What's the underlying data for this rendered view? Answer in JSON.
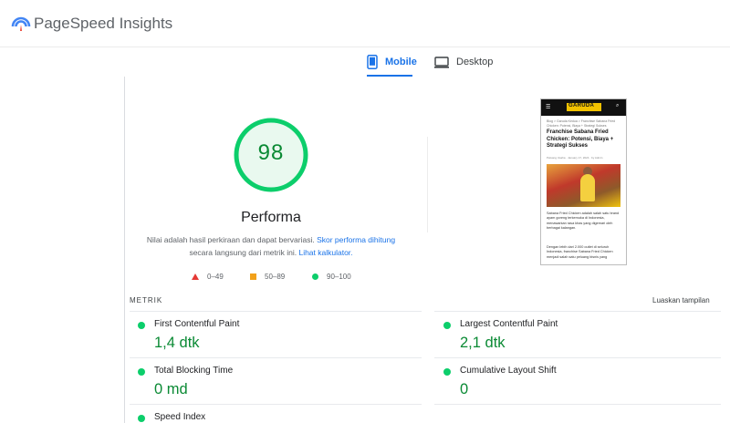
{
  "header": {
    "title": "PageSpeed Insights"
  },
  "tabs": [
    {
      "label": "Mobile",
      "active": true,
      "icon": "phone-icon"
    },
    {
      "label": "Desktop",
      "active": false,
      "icon": "monitor-icon"
    }
  ],
  "score": {
    "value": "98",
    "category": "Performa",
    "desc_prefix": "Nilai adalah hasil perkiraan dan dapat bervariasi. ",
    "desc_link1": "Skor performa dihitung",
    "desc_mid": "secara langsung dari metrik ini. ",
    "desc_link2": "Lihat kalkulator.",
    "color": "#0cce6b"
  },
  "legend": [
    {
      "range": "0–49",
      "shape": "triangle",
      "color": "#e53935"
    },
    {
      "range": "50–89",
      "shape": "square",
      "color": "#f2a11a"
    },
    {
      "range": "90–100",
      "shape": "circle",
      "color": "#0cce6b"
    }
  ],
  "preview": {
    "logo": "GARUDA",
    "breadcrumb": "Blog > Garuda Kedua > Franchise Sabana Fried Chicken: Potensi, Biaya + Strategi Sukses",
    "title": "Franchise Sabana Fried Chicken: Potensi, Biaya + Strategi Sukses",
    "meta": "Peluang Usaha · January 17, 2024 · by Admin",
    "paragraph1": "Sabana Fried Chicken adalah salah satu brand ayam goreng terkemuka di Indonesia, menawarkan rasa khas yang digemari oleh berbagai kalangan.",
    "paragraph2": "Dengan lebih dari 2.000 outlet di seluruh Indonesia, franchise Sabana Fried Chicken menjadi salah satu peluang bisnis yang"
  },
  "metrics": {
    "section_label": "METRIK",
    "toggle_label": "Luaskan tampilan",
    "items": [
      {
        "label": "First Contentful Paint",
        "value": "1,4 dtk"
      },
      {
        "label": "Largest Contentful Paint",
        "value": "2,1 dtk"
      },
      {
        "label": "Total Blocking Time",
        "value": "0 md"
      },
      {
        "label": "Cumulative Layout Shift",
        "value": "0"
      },
      {
        "label": "Speed Index",
        "value": ""
      }
    ]
  }
}
